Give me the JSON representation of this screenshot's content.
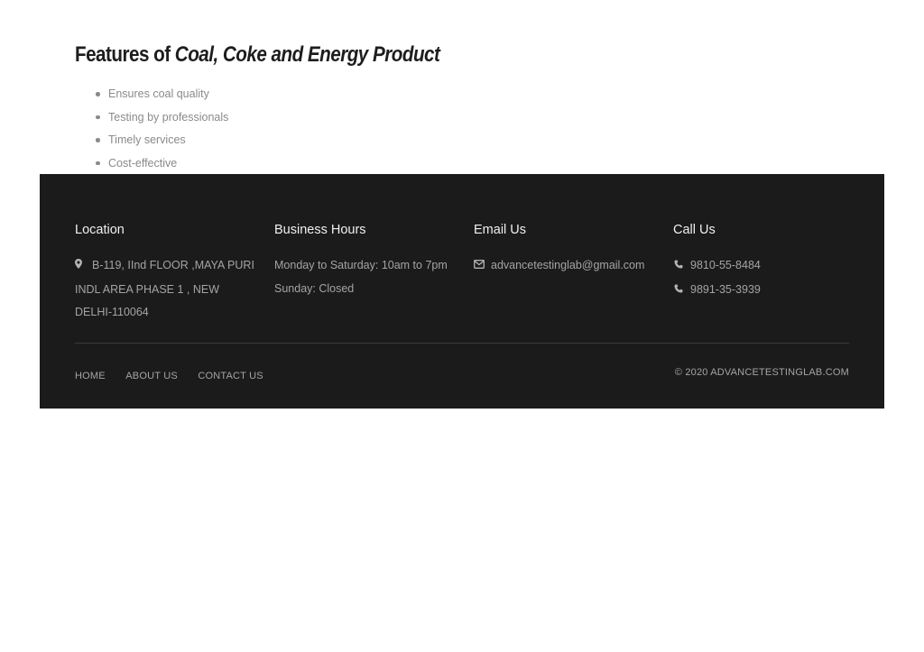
{
  "features": {
    "title_prefix": "Features of",
    "title_emphasis": "Coal, Coke and Energy Product",
    "items": [
      "Ensures coal quality",
      "Testing by professionals",
      "Timely services",
      "Cost-effective"
    ]
  },
  "footer": {
    "location": {
      "heading": "Location",
      "icon": "map-marker-icon",
      "address": "B-119, IInd FLOOR ,MAYA PURI INDL AREA PHASE 1 , NEW DELHI-110064"
    },
    "hours": {
      "heading": "Business Hours",
      "lines": [
        "Monday to Saturday: 10am to 7pm",
        "Sunday: Closed"
      ]
    },
    "email": {
      "heading": "Email Us",
      "icon": "envelope-icon",
      "address": "advancetestinglab@gmail.com"
    },
    "call": {
      "heading": "Call Us",
      "icon": "phone-icon",
      "numbers": [
        "9810-55-8484",
        "9891-35-3939"
      ]
    },
    "nav": [
      "HOME",
      "ABOUT US",
      "CONTACT US"
    ],
    "copyright": "© 2020 ADVANCETESTINGLAB.COM"
  }
}
